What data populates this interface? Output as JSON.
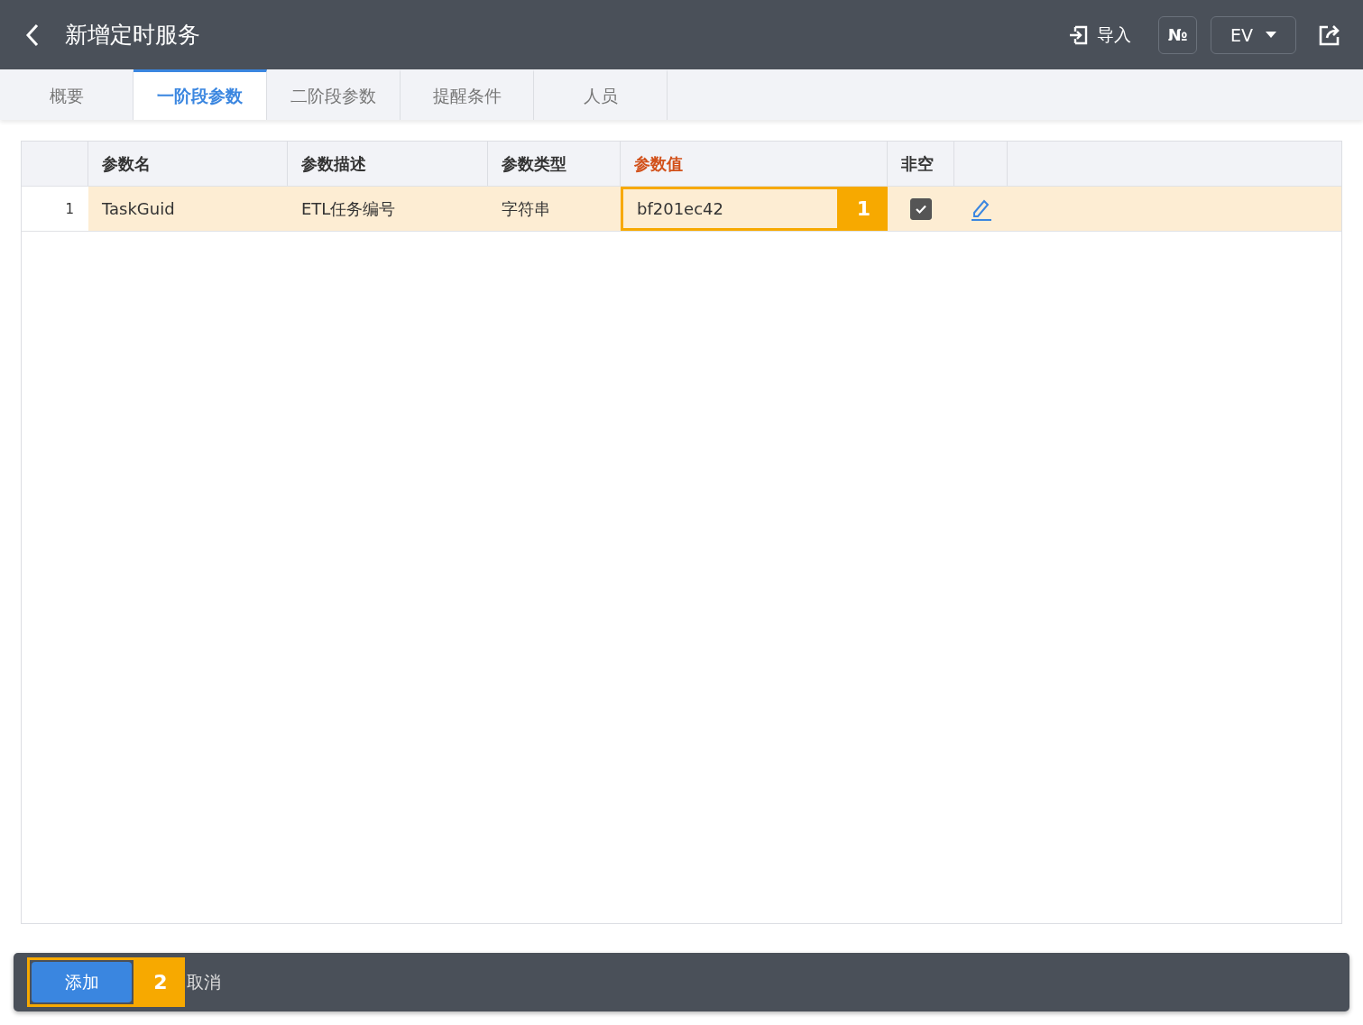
{
  "header": {
    "title": "新增定时服务",
    "import_label": "导入",
    "number_label": "№",
    "dropdown": {
      "value": "EV"
    }
  },
  "tabs": [
    {
      "label": "概要",
      "selected": false
    },
    {
      "label": "一阶段参数",
      "selected": true
    },
    {
      "label": "二阶段参数",
      "selected": false
    },
    {
      "label": "提醒条件",
      "selected": false
    },
    {
      "label": "人员",
      "selected": false
    }
  ],
  "table": {
    "columns": [
      {
        "label": "参数名",
        "highlighted": false
      },
      {
        "label": "参数描述",
        "highlighted": false
      },
      {
        "label": "参数类型",
        "highlighted": false
      },
      {
        "label": "参数值",
        "highlighted": true
      },
      {
        "label": "非空",
        "highlighted": false
      }
    ],
    "rows": [
      {
        "index": "1",
        "name": "TaskGuid",
        "description": "ETL任务编号",
        "type": "字符串",
        "value": "bf201ec42",
        "not_null": true,
        "selected": true
      }
    ]
  },
  "callouts": [
    {
      "label": "1"
    },
    {
      "label": "2"
    }
  ],
  "footer": {
    "buttons": [
      {
        "label": "添加",
        "kind": "primary"
      },
      {
        "label": "取消",
        "kind": "text"
      }
    ]
  }
}
